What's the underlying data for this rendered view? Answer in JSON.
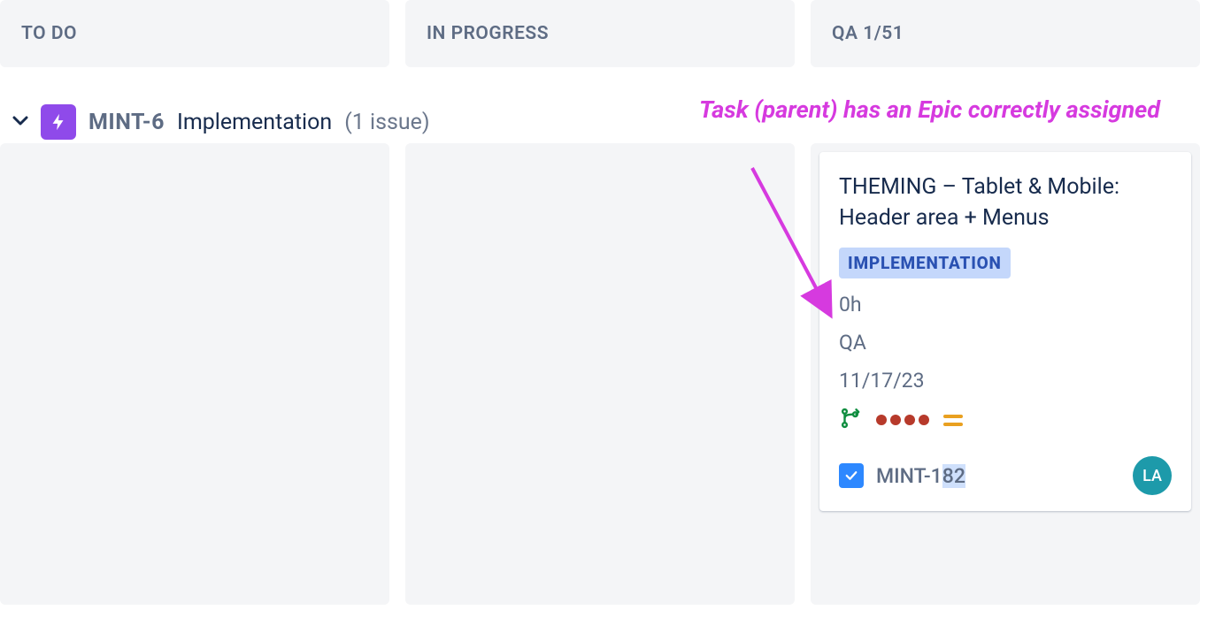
{
  "columns": {
    "todo": {
      "header": "TO DO"
    },
    "inprogress": {
      "header": "IN PROGRESS"
    },
    "qa": {
      "header": "QA 1/51"
    }
  },
  "epic_row": {
    "key": "MINT-6",
    "title": "Implementation",
    "count": "(1 issue)"
  },
  "card": {
    "title": "THEMING – Tablet & Mobile: Header area + Menus",
    "epic_label": "IMPLEMENTATION",
    "time": "0h",
    "status": "QA",
    "date": "11/17/23",
    "issue_key_prefix": "MINT-1",
    "issue_key_suffix": "82",
    "avatar_initials": "LA"
  },
  "annotation": {
    "text": "Task (parent) has an Epic correctly assigned"
  }
}
